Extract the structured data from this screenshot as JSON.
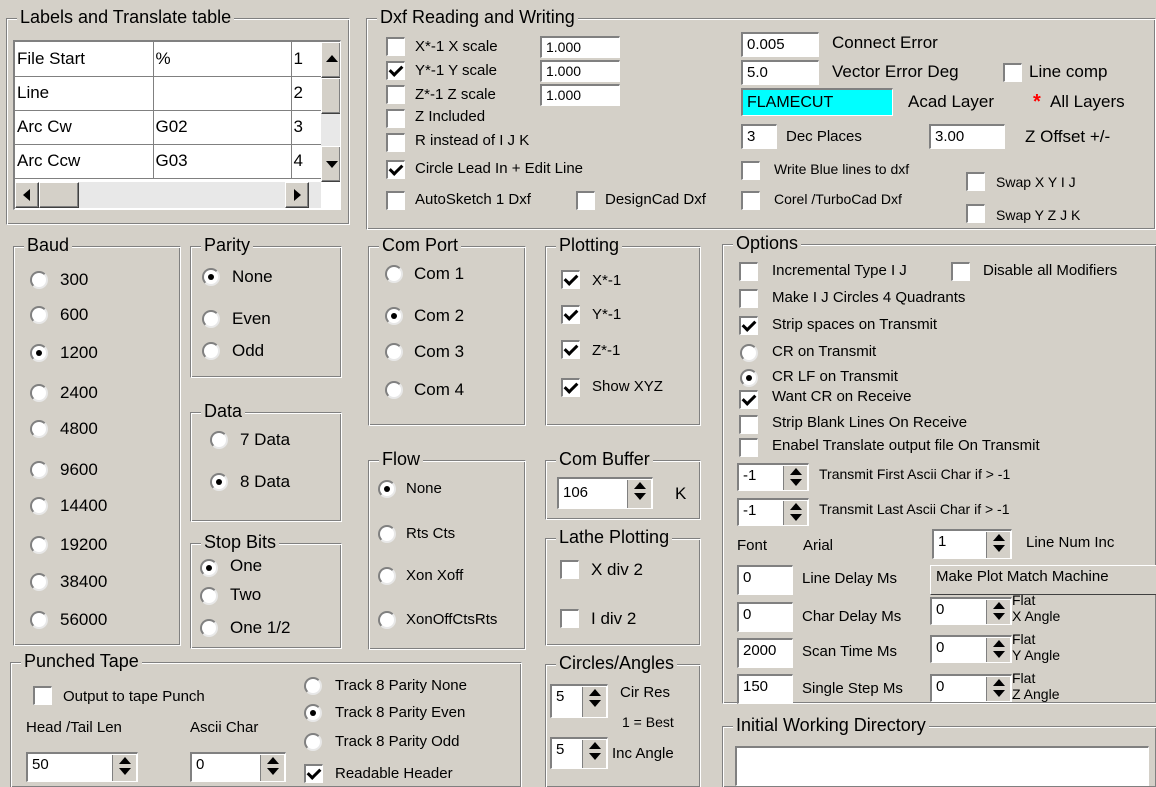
{
  "translate": {
    "legend": "Labels  and Translate table",
    "rows": [
      {
        "label": "File Start",
        "code": "%",
        "num": "1"
      },
      {
        "label": "Line",
        "code": "",
        "num": "2"
      },
      {
        "label": "Arc Cw",
        "code": "G02",
        "num": "3"
      },
      {
        "label": "Arc Ccw",
        "code": "G03",
        "num": "4"
      }
    ]
  },
  "dxf": {
    "legend": "Dxf   Reading and Writing",
    "xscale_label": "X*-1  X scale",
    "xscale": "1.000",
    "yscale_label": "Y*-1  Y scale",
    "yscale": "1.000",
    "zscale_label": "Z*-1  Z scale",
    "zscale": "1.000",
    "z_included": "Z Included",
    "r_instead": "R instead of I J K",
    "circle_lead": "Circle Lead In + Edit Line",
    "autosketch": "AutoSketch 1 Dxf",
    "designcad": "DesignCad Dxf",
    "connect_error_val": "0.005",
    "connect_error": "Connect Error",
    "vector_error_val": "5.0",
    "vector_error": "Vector Error Deg",
    "line_comp": "Line comp",
    "layer_val": "FLAMECUT",
    "acad_layer": "Acad Layer",
    "all_layers": "All Layers",
    "dec_places_val": "3",
    "dec_places": "Dec Places",
    "z_offset_val": "3.00",
    "z_offset": "Z Offset +/-",
    "write_blue": "Write Blue lines to dxf",
    "corel": "Corel /TurboCad Dxf",
    "swap_xy": "Swap X Y  I J",
    "swap_yz": "Swap Y Z  J K"
  },
  "baud": {
    "legend": "Baud",
    "options": [
      "300",
      "600",
      "1200",
      "2400",
      "4800",
      "9600",
      "14400",
      "19200",
      "38400",
      "56000"
    ],
    "selected": "1200"
  },
  "parity": {
    "legend": "Parity",
    "options": [
      "None",
      "Even",
      "Odd"
    ],
    "selected": "None"
  },
  "data_bits": {
    "legend": "Data",
    "options": [
      "7 Data",
      "8 Data"
    ],
    "selected": "8 Data"
  },
  "stop_bits": {
    "legend": "Stop Bits",
    "options": [
      "One",
      "Two",
      "One 1/2"
    ],
    "selected": "One"
  },
  "com_port": {
    "legend": "Com Port",
    "options": [
      "Com 1",
      "Com 2",
      "Com 3",
      "Com 4"
    ],
    "selected": "Com 2"
  },
  "plotting": {
    "legend": "Plotting",
    "x": "X*-1",
    "y": "Y*-1",
    "z": "Z*-1",
    "show_xyz": "Show XYZ"
  },
  "flow": {
    "legend": "Flow",
    "options": [
      "None",
      "Rts Cts",
      "Xon Xoff",
      "XonOffCtsRts"
    ],
    "selected": "None"
  },
  "com_buffer": {
    "legend": "Com Buffer",
    "value": "106",
    "unit": "K"
  },
  "lathe": {
    "legend": "Lathe Plotting",
    "x_div": "X div  2",
    "i_div": "I div  2"
  },
  "circles": {
    "legend": "Circles/Angles",
    "cir_res_val": "5",
    "cir_res": "Cir Res",
    "best": "1 = Best",
    "inc_angle_val": "5",
    "inc_angle": "Inc Angle"
  },
  "options": {
    "legend": "Options",
    "incremental": "Incremental  Type I J",
    "disable_mod": "Disable all Modifiers",
    "make_ij": "Make  I J Circles 4 Quadrants",
    "strip_spaces": "Strip spaces  on Transmit",
    "cr_transmit": "CR on Transmit",
    "crlf_transmit": "CR LF on Transmit",
    "want_cr": "Want CR on Receive",
    "strip_blank": "Strip Blank Lines On Receive",
    "enabel_translate": "Enabel Translate output file On Transmit",
    "first_val": "-1",
    "first_label": "Transmit First Ascii Char if > -1",
    "last_val": "-1",
    "last_label": "Transmit Last Ascii Char if > -1",
    "font_label": "Font",
    "font_val": "Arial",
    "line_num_val": "1",
    "line_num": "Line Num Inc",
    "line_delay_val": "0",
    "line_delay": "Line Delay Ms",
    "plot_match": "Make Plot Match Machine",
    "char_delay_val": "0",
    "char_delay": "Char Delay Ms",
    "flat_x_val": "0",
    "flat_x": "X Angle",
    "scan_val": "2000",
    "scan": "Scan Time Ms",
    "flat_y_val": "0",
    "flat_y": "Y Angle",
    "step_val": "150",
    "step": "Single Step Ms",
    "flat_z_val": "0",
    "flat_z": "Z Angle",
    "flat": "Flat"
  },
  "dir": {
    "legend": "Initial Working Directory",
    "value": ""
  },
  "tape": {
    "legend": "Punched Tape",
    "output": "Output to tape Punch",
    "head_tail": "Head /Tail Len",
    "head_val": "50",
    "ascii_char": "Ascii Char",
    "ascii_val": "0",
    "track_none": "Track 8 Parity None",
    "track_even": "Track 8 Parity Even",
    "track_odd": "Track 8 Parity Odd",
    "readable": "Readable Header"
  },
  "colors": {
    "layer_bg": "#00ffff",
    "asterisk": "#ff0000"
  }
}
